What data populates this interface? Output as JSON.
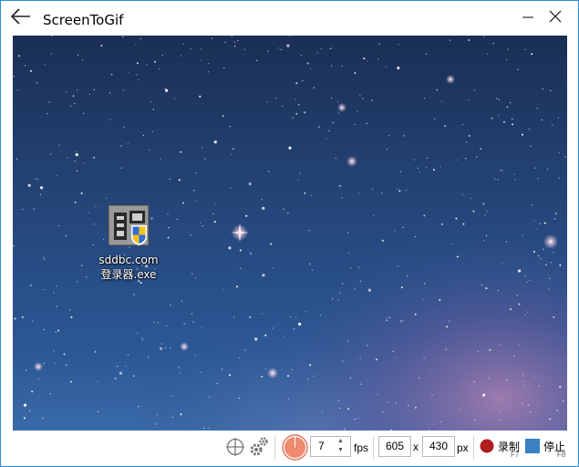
{
  "window": {
    "title": "ScreenToGif",
    "accent": "#2c8fd8"
  },
  "titlebar": {
    "back_icon": "arrow-left-icon",
    "minimize_icon": "minimize-icon",
    "close_icon": "close-icon"
  },
  "desktop": {
    "icon_name": "app-exe-icon",
    "label_line1": "sddbc.com",
    "label_line2": "登录器.exe"
  },
  "toolbar": {
    "snap_icon": "crosshair-icon",
    "options_icon": "gears-icon",
    "framerate_icon": "gauge-icon",
    "fps_value": "7",
    "fps_unit": "fps",
    "width_value": "605",
    "times": "x",
    "height_value": "430",
    "px_unit": "px",
    "record_label": "录制",
    "record_hotkey": "F7",
    "record_color": "#b01e1e",
    "stop_label": "停止",
    "stop_hotkey": "F8",
    "stop_color": "#3b80c4"
  }
}
